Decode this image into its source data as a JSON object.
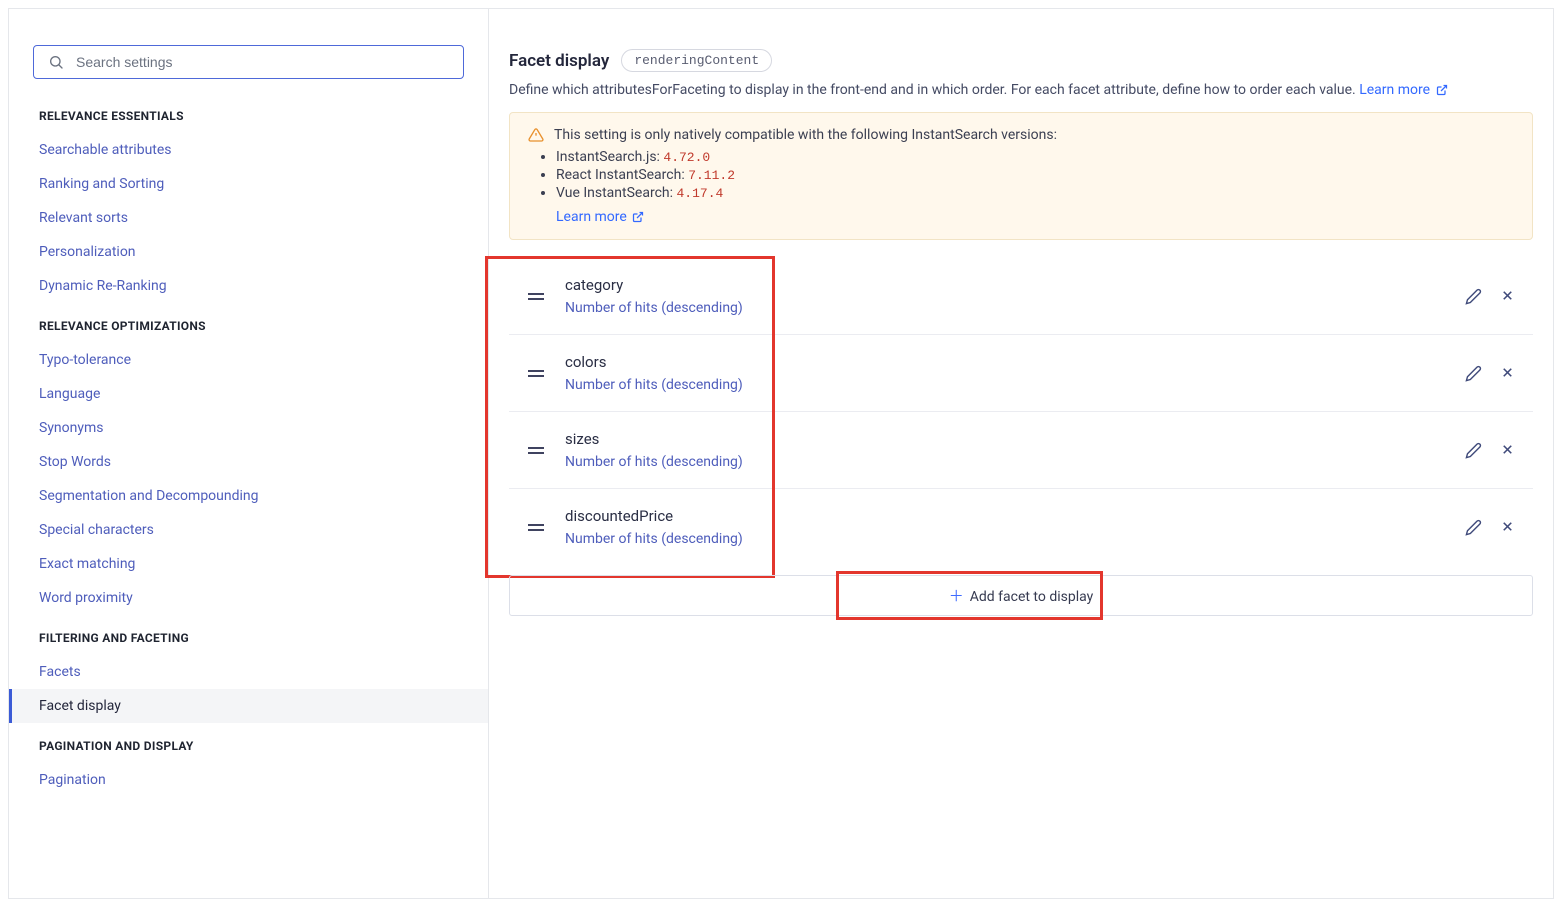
{
  "search": {
    "placeholder": "Search settings"
  },
  "sidebar": {
    "sections": [
      {
        "heading": "RELEVANCE ESSENTIALS",
        "items": [
          {
            "label": "Searchable attributes",
            "active": false
          },
          {
            "label": "Ranking and Sorting",
            "active": false
          },
          {
            "label": "Relevant sorts",
            "active": false
          },
          {
            "label": "Personalization",
            "active": false
          },
          {
            "label": "Dynamic Re-Ranking",
            "active": false
          }
        ]
      },
      {
        "heading": "RELEVANCE OPTIMIZATIONS",
        "items": [
          {
            "label": "Typo-tolerance",
            "active": false
          },
          {
            "label": "Language",
            "active": false
          },
          {
            "label": "Synonyms",
            "active": false
          },
          {
            "label": "Stop Words",
            "active": false
          },
          {
            "label": "Segmentation and Decompounding",
            "active": false
          },
          {
            "label": "Special characters",
            "active": false
          },
          {
            "label": "Exact matching",
            "active": false
          },
          {
            "label": "Word proximity",
            "active": false
          }
        ]
      },
      {
        "heading": "FILTERING AND FACETING",
        "items": [
          {
            "label": "Facets",
            "active": false
          },
          {
            "label": "Facet display",
            "active": true
          }
        ]
      },
      {
        "heading": "PAGINATION AND DISPLAY",
        "items": [
          {
            "label": "Pagination",
            "active": false
          }
        ]
      }
    ]
  },
  "main": {
    "title": "Facet display",
    "code_tag": "renderingContent",
    "description": "Define which attributesForFaceting to display in the front-end and in which order. For each facet attribute, define how to order each value.",
    "learn_more_label": "Learn more",
    "warning": {
      "intro": "This setting is only natively compatible with the following InstantSearch versions:",
      "libs": [
        {
          "name": "InstantSearch.js:",
          "version": "4.72.0"
        },
        {
          "name": "React InstantSearch:",
          "version": "7.11.2"
        },
        {
          "name": "Vue InstantSearch:",
          "version": "4.17.4"
        }
      ],
      "learn_more": "Learn more"
    },
    "facets": [
      {
        "name": "category",
        "subtitle": "Number of hits (descending)"
      },
      {
        "name": "colors",
        "subtitle": "Number of hits (descending)"
      },
      {
        "name": "sizes",
        "subtitle": "Number of hits (descending)"
      },
      {
        "name": "discountedPrice",
        "subtitle": "Number of hits (descending)"
      }
    ],
    "add_button": "Add facet to display"
  }
}
